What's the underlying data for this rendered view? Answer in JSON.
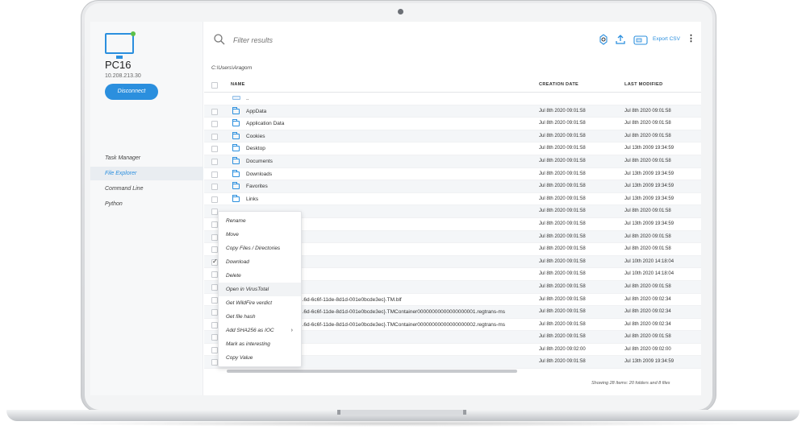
{
  "device": {
    "name": "PC16",
    "ip": "10.208.213.30",
    "disconnect_label": "Disconnect",
    "online_color": "#5cc04a"
  },
  "nav": {
    "items": [
      {
        "label": "Task Manager"
      },
      {
        "label": "File Explorer"
      },
      {
        "label": "Command Line"
      },
      {
        "label": "Python"
      }
    ]
  },
  "toolbar": {
    "search_placeholder": "Filter results",
    "export_label": "Export CSV"
  },
  "path": "C:\\Users\\Aragorn",
  "table": {
    "headers": {
      "name": "NAME",
      "created": "CREATION DATE",
      "modified": "LAST MODIFIED"
    },
    "up_label": "..",
    "rows": [
      {
        "name": "AppData",
        "created": "Jul 8th 2020 09:01:58",
        "modified": "Jul 8th 2020 09:01:58"
      },
      {
        "name": "Application Data",
        "created": "Jul 8th 2020 09:01:58",
        "modified": "Jul 8th 2020 09:01:58"
      },
      {
        "name": "Cookies",
        "created": "Jul 8th 2020 09:01:58",
        "modified": "Jul 8th 2020 09:01:58"
      },
      {
        "name": "Desktop",
        "created": "Jul 8th 2020 09:01:58",
        "modified": "Jul 13th 2009 19:34:59"
      },
      {
        "name": "Documents",
        "created": "Jul 8th 2020 09:01:58",
        "modified": "Jul 8th 2020 09:01:58"
      },
      {
        "name": "Downloads",
        "created": "Jul 8th 2020 09:01:58",
        "modified": "Jul 13th 2009 19:34:59"
      },
      {
        "name": "Favorites",
        "created": "Jul 8th 2020 09:01:58",
        "modified": "Jul 13th 2009 19:34:59"
      },
      {
        "name": "Links",
        "created": "Jul 8th 2020 09:01:58",
        "modified": "Jul 13th 2009 19:34:59"
      },
      {
        "name": "",
        "created": "Jul 8th 2020 09:01:58",
        "modified": "Jul 8th 2020 09:01:58"
      },
      {
        "name": "",
        "created": "Jul 8th 2020 09:01:58",
        "modified": "Jul 13th 2009 19:34:59"
      },
      {
        "name": "",
        "created": "Jul 8th 2020 09:01:58",
        "modified": "Jul 8th 2020 09:01:58"
      },
      {
        "name": "",
        "created": "Jul 8th 2020 09:01:58",
        "modified": "Jul 8th 2020 09:01:58"
      },
      {
        "name": "",
        "created": "Jul 8th 2020 09:01:58",
        "modified": "Jul 10th 2020 14:18:04"
      },
      {
        "name": "",
        "created": "Jul 8th 2020 09:01:58",
        "modified": "Jul 10th 2020 14:18:04"
      },
      {
        "name": "",
        "created": "Jul 8th 2020 09:01:58",
        "modified": "Jul 8th 2020 09:01:58"
      },
      {
        "name": "...6d-6c6f-11de-8d1d-001e0bcde3ec}.TM.blf",
        "created": "Jul 8th 2020 09:01:58",
        "modified": "Jul 8th 2020 09:02:34"
      },
      {
        "name": "...6d-6c6f-11de-8d1d-001e0bcde3ec}.TMContainer00000000000000000001.regtrans-ms",
        "created": "Jul 8th 2020 09:01:58",
        "modified": "Jul 8th 2020 09:02:34"
      },
      {
        "name": "...6d-6c6f-11de-8d1d-001e0bcde3ec}.TMContainer00000000000000000002.regtrans-ms",
        "created": "Jul 8th 2020 09:01:58",
        "modified": "Jul 8th 2020 09:02:34"
      },
      {
        "name": "",
        "created": "Jul 8th 2020 09:01:58",
        "modified": "Jul 8th 2020 09:01:58"
      },
      {
        "name": "",
        "created": "Jul 8th 2020 09:02:00",
        "modified": "Jul 8th 2020 09:02:00"
      },
      {
        "name": "",
        "created": "Jul 8th 2020 09:01:58",
        "modified": "Jul 13th 2009 19:34:59"
      }
    ]
  },
  "context_menu": {
    "items": [
      {
        "label": "Rename"
      },
      {
        "label": "Move"
      },
      {
        "label": "Copy Files / Directories"
      },
      {
        "label": "Download"
      },
      {
        "label": "Delete"
      },
      {
        "label": "Open in VirusTotal"
      },
      {
        "label": "Get WildFire verdict"
      },
      {
        "label": "Get file hash"
      },
      {
        "label": "Add SHA256 as IOC",
        "submenu_arrow": "›"
      },
      {
        "label": "Mark as interesting"
      },
      {
        "label": "Copy Value"
      }
    ]
  },
  "footer": "Showing 28 Items: 20 folders and 8 files",
  "colors": {
    "accent": "#2b8fde"
  }
}
